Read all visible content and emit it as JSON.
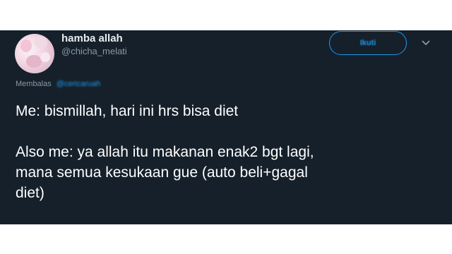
{
  "user": {
    "display_name": "hamba allah",
    "handle": "@chicha_melati"
  },
  "follow_button": {
    "label": "Ikuti"
  },
  "reply": {
    "label": "Membalas",
    "mention": "@cericaruah"
  },
  "tweet": {
    "line1": "Me: bismillah, hari ini hrs bisa diet",
    "line2": "Also me: ya allah itu makanan enak2 bgt lagi,",
    "line3": "mana semua kesukaan gue (auto beli+gagal",
    "line4": "diet)"
  },
  "colors": {
    "background": "#15202b",
    "accent": "#1d9bf0",
    "secondary_text": "#8899a6"
  },
  "icons": {
    "menu": "chevron-down-icon"
  }
}
